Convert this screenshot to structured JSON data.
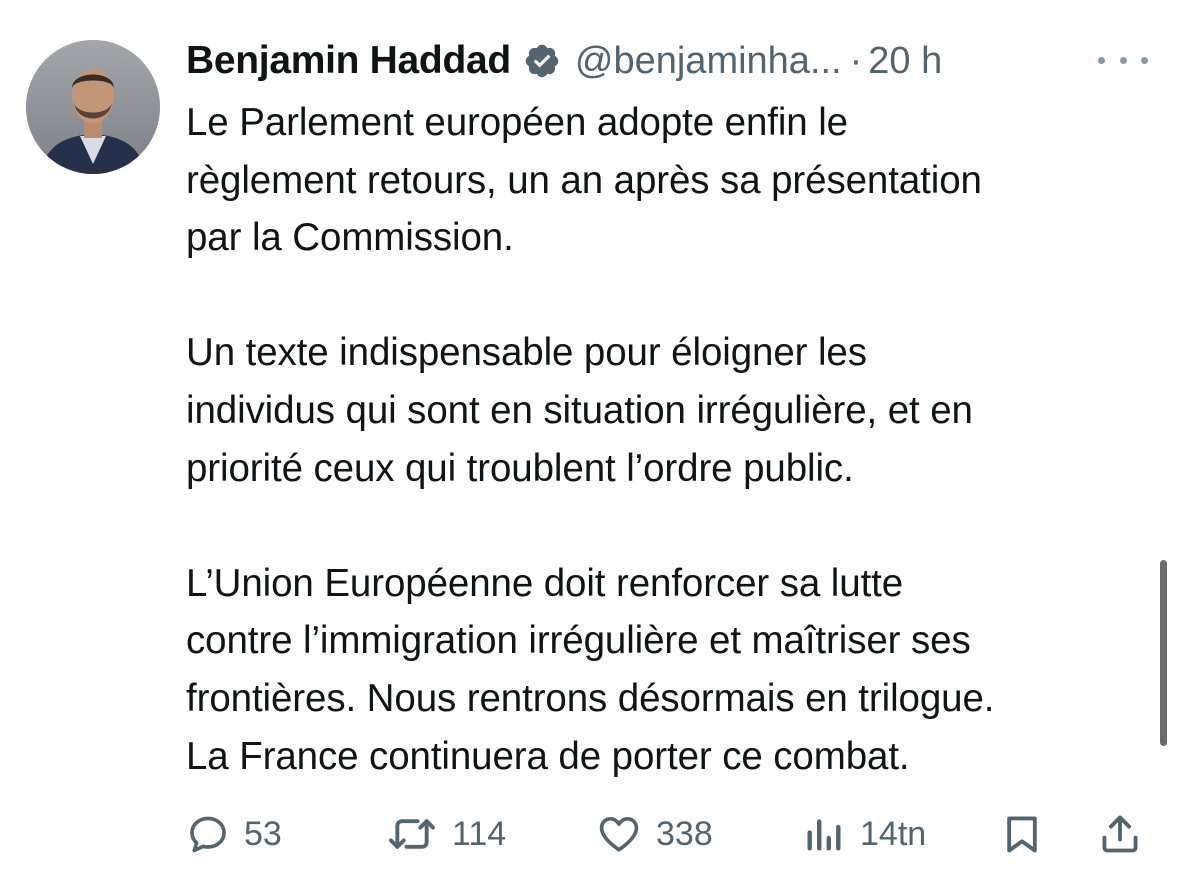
{
  "author": {
    "display_name": "Benjamin Haddad",
    "handle": "@benjaminha...",
    "separator": "·",
    "time": "20 h",
    "verified": true,
    "verified_color": "#1d9bf0"
  },
  "tweet": {
    "paragraphs": [
      [
        "Le Parlement européen adopte enfin le",
        "règlement retours, un an après sa présentation",
        "par la Commission."
      ],
      [
        "Un texte indispensable pour éloigner les",
        "individus qui sont en situation irrégulière, et en",
        "priorité ceux qui troublent l’ordre public."
      ],
      [
        "L’Union Européenne doit renforcer sa lutte",
        "contre l’immigration irrégulière et maîtriser ses",
        "frontières. Nous rentrons désormais en trilogue.",
        "La France continuera de porter ce combat."
      ]
    ]
  },
  "actions": {
    "replies": "53",
    "retweets": "114",
    "likes": "338",
    "views": "14tn",
    "icons": [
      "reply-icon",
      "retweet-icon",
      "like-icon",
      "views-icon",
      "bookmark-icon",
      "share-icon"
    ]
  },
  "colors": {
    "text": "#0f1419",
    "secondary": "#536471",
    "icon": "#536471"
  }
}
